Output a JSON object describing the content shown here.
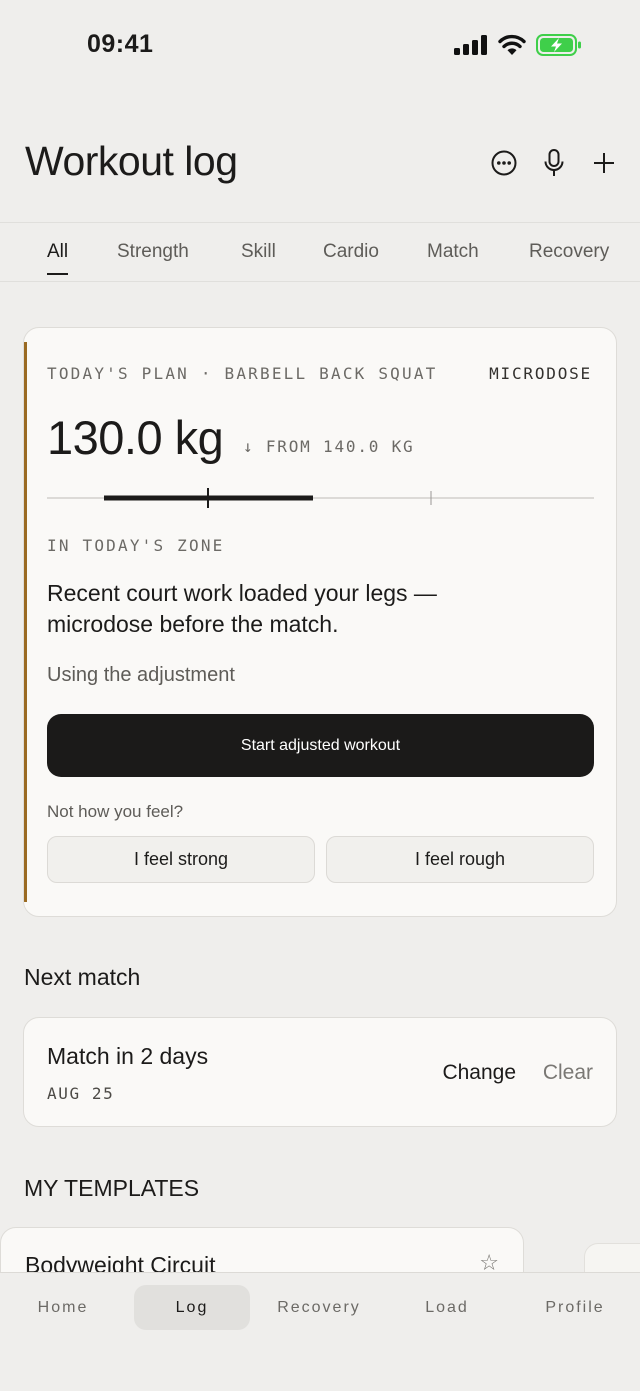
{
  "status_bar": {
    "time": "09:41",
    "icons": [
      "signal-icon",
      "wifi-icon",
      "battery-charging-icon"
    ],
    "battery_color": "#3fcf4a"
  },
  "header": {
    "title": "Workout log",
    "actions": [
      "more-icon",
      "microphone-icon",
      "plus-icon"
    ]
  },
  "tabs": [
    {
      "label": "All",
      "active": true
    },
    {
      "label": "Strength",
      "active": false
    },
    {
      "label": "Skill",
      "active": false
    },
    {
      "label": "Cardio",
      "active": false
    },
    {
      "label": "Match",
      "active": false
    },
    {
      "label": "Recovery",
      "active": false
    }
  ],
  "plan": {
    "eyebrow": "TODAY'S PLAN · BARBELL BACK SQUAT",
    "tag": "MICRODOSE",
    "weight": "130.0 kg",
    "from_text": "↓ FROM 140.0 KG",
    "zone_label": "IN TODAY'S ZONE",
    "message": "Recent court work loaded your legs — microdose before the match.",
    "sub": "Using the adjustment",
    "primary_button": "Start adjusted workout",
    "feel_prompt": "Not how you feel?",
    "feel_strong": "I feel strong",
    "feel_rough": "I feel rough",
    "accent_color": "#9a6a22"
  },
  "next_match": {
    "section_title": "Next match",
    "title": "Match in 2 days",
    "date": "AUG 25",
    "change": "Change",
    "clear": "Clear"
  },
  "templates": {
    "section_title": "MY TEMPLATES",
    "items": [
      {
        "name": "Bodyweight Circuit"
      }
    ]
  },
  "bottom_nav": [
    {
      "label": "Home",
      "active": false
    },
    {
      "label": "Log",
      "active": true
    },
    {
      "label": "Recovery",
      "active": false
    },
    {
      "label": "Load",
      "active": false
    },
    {
      "label": "Profile",
      "active": false
    }
  ]
}
